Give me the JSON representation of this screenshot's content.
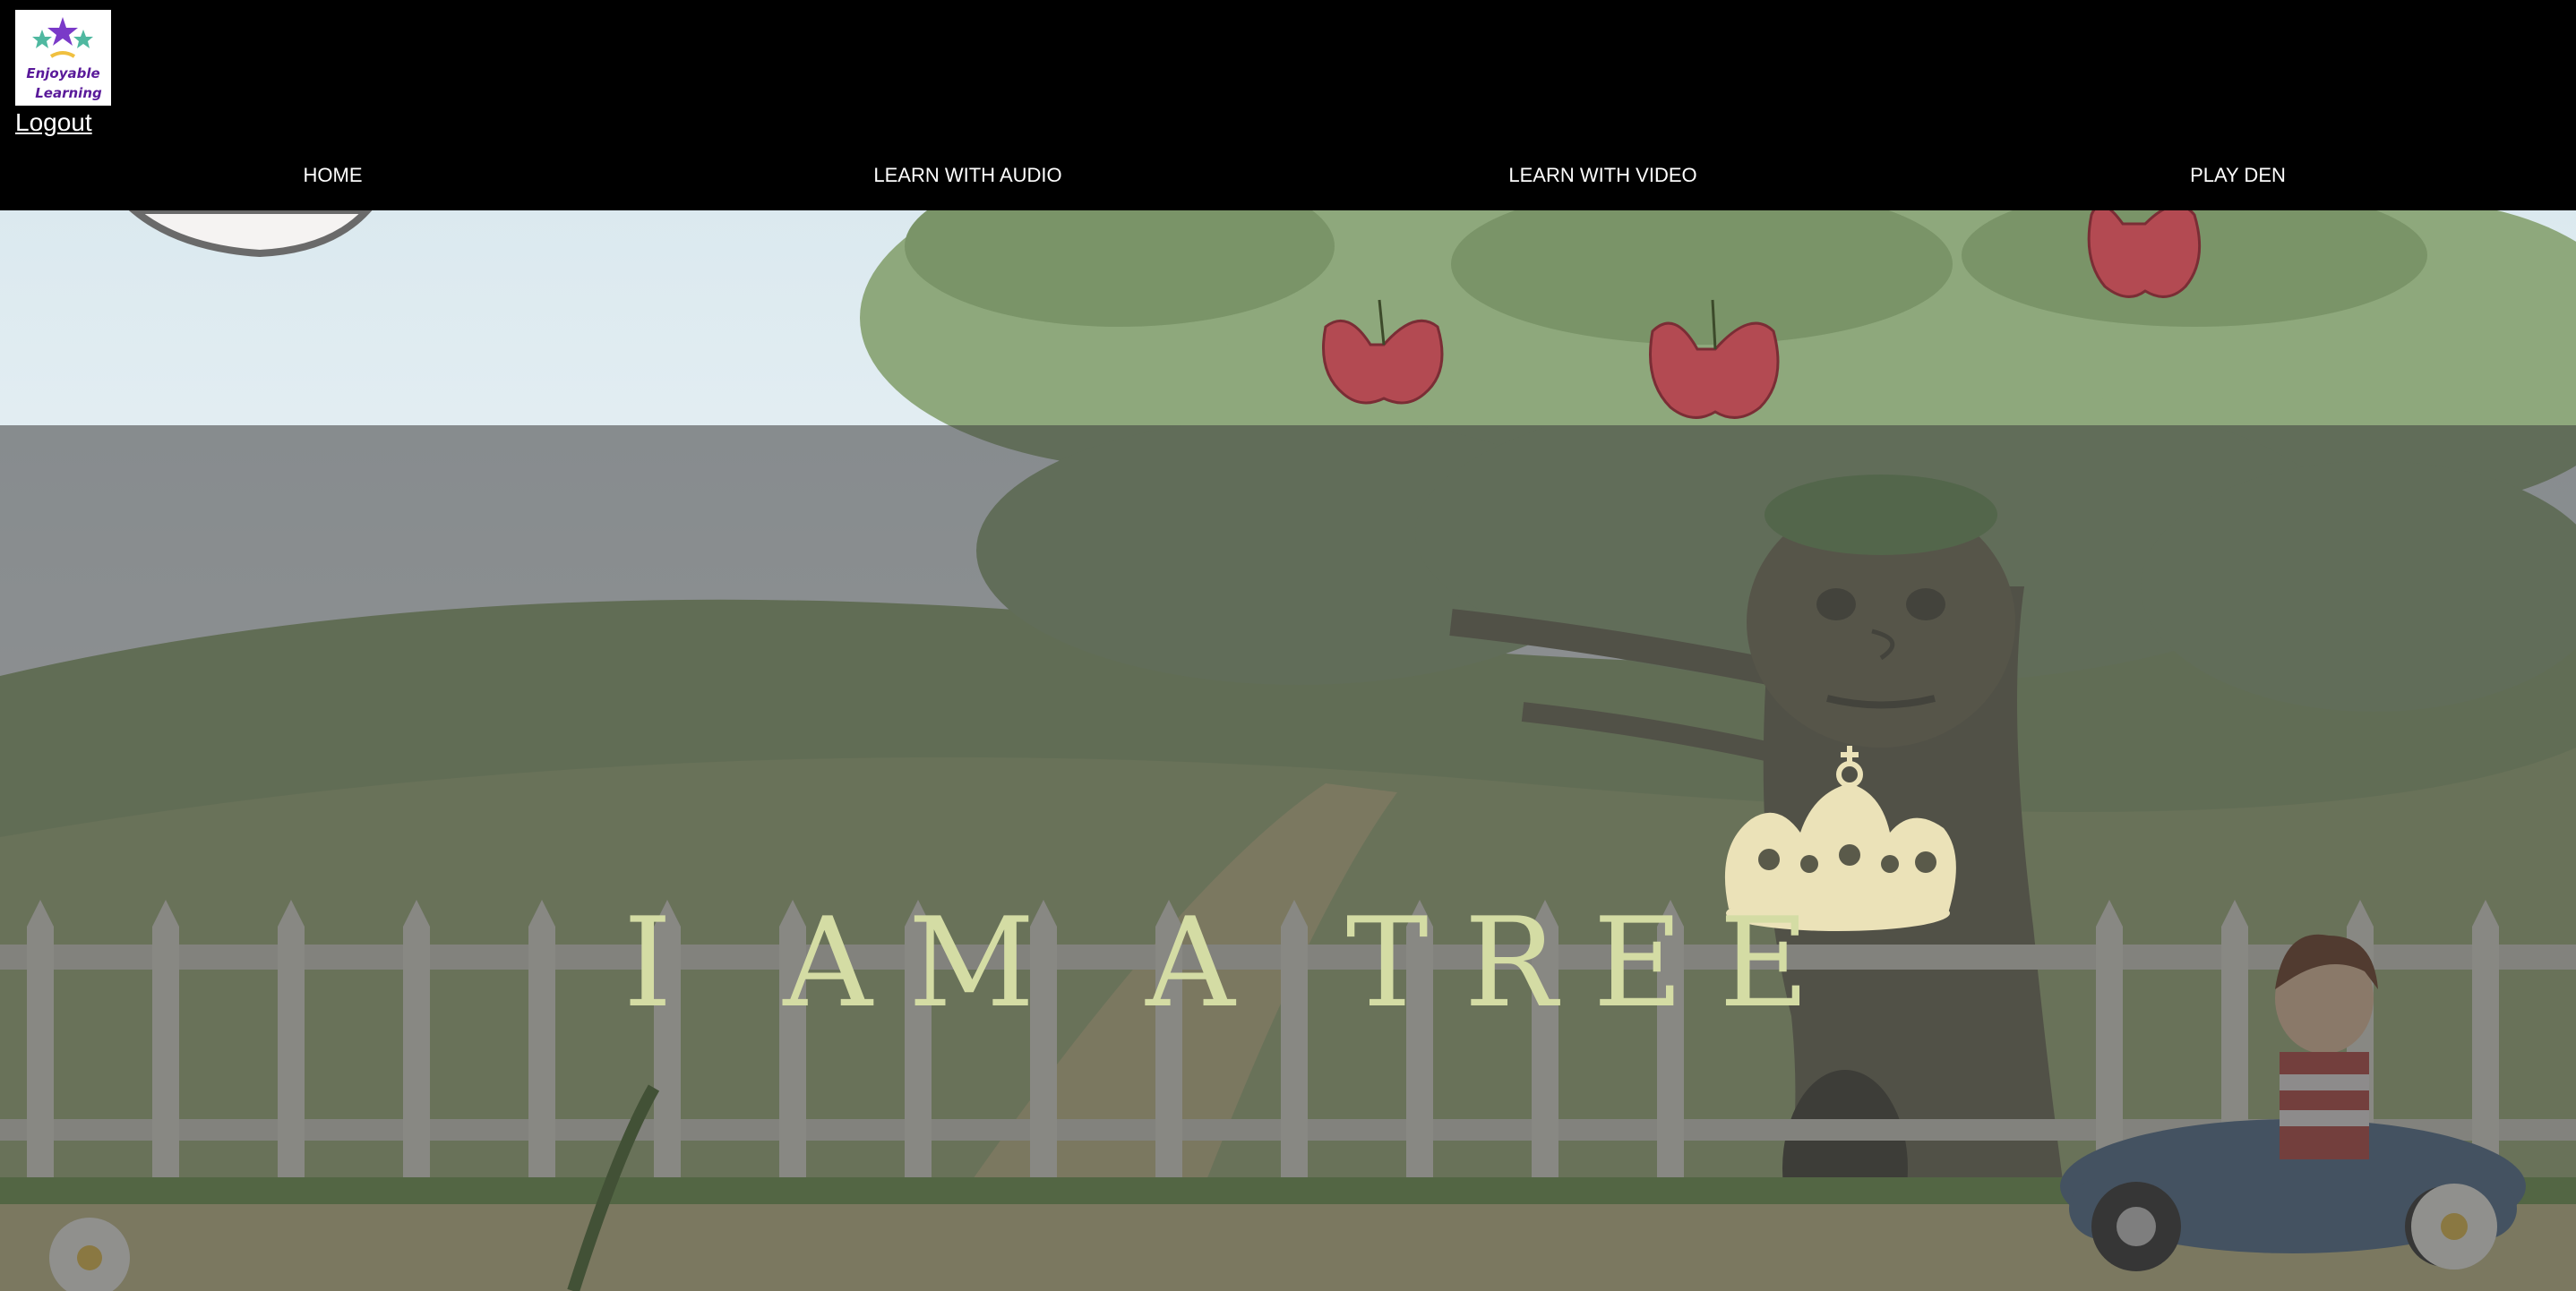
{
  "brand": {
    "logo_line1": "Enjoyable",
    "logo_line2": "Learning",
    "logo_icon": "stars-people-icon"
  },
  "header": {
    "logout_label": "Logout",
    "nav": [
      {
        "label": "HOME"
      },
      {
        "label": "LEARN WITH AUDIO"
      },
      {
        "label": "LEARN WITH VIDEO"
      },
      {
        "label": "PLAY DEN"
      }
    ]
  },
  "hero": {
    "title": "I AM A TREE",
    "emblem": "crown-icon",
    "text_color": "#d4dca4"
  },
  "colors": {
    "header_bg": "#000000",
    "sky": "#e8f1f4",
    "foliage": "#8fa57e",
    "apple": "#b34a52",
    "overlay": "rgba(60,60,60,0.55)"
  }
}
